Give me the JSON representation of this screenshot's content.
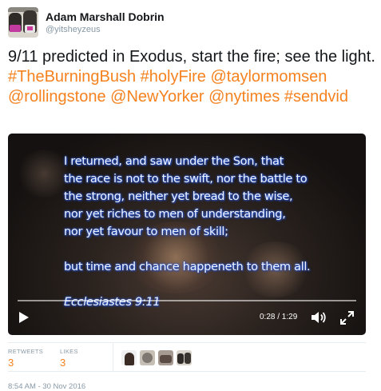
{
  "author": {
    "display_name": "Adam Marshall Dobrin",
    "handle": "@yitsheyzeus",
    "avatar_icon": "profile-photo-two-people"
  },
  "tweet": {
    "text_plain": "9/11 predicted in Exodus, start the fire; see the light.",
    "entities": [
      "#TheBurningBush",
      "#holyFire",
      "@taylormomsen",
      "@rollingstone",
      "@NewYorker",
      "@nytimes",
      "#sendvid"
    ],
    "link_color": "#f5821f"
  },
  "video": {
    "verse_lines": [
      "I returned, and saw under the Son, that",
      "the race is not to the swift, nor the battle to",
      "the strong, neither yet bread to the wise,",
      "nor yet riches to men of understanding,",
      "nor yet favour to men of skill;",
      "but time and chance happeneth to them all.",
      "Ecclesiastes 9:11"
    ],
    "current_time": "0:28",
    "duration": "1:29",
    "time_display": "0:28 / 1:29",
    "progress_fraction": 0.0,
    "play_icon": "play-icon",
    "volume_icon": "volume-icon",
    "fullscreen_icon": "fullscreen-icon"
  },
  "stats": {
    "retweets_label": "RETWEETS",
    "retweets_count": "3",
    "likes_label": "LIKES",
    "likes_count": "3",
    "liker_avatars": 4
  },
  "timestamp": "8:54 AM - 30 Nov 2016"
}
